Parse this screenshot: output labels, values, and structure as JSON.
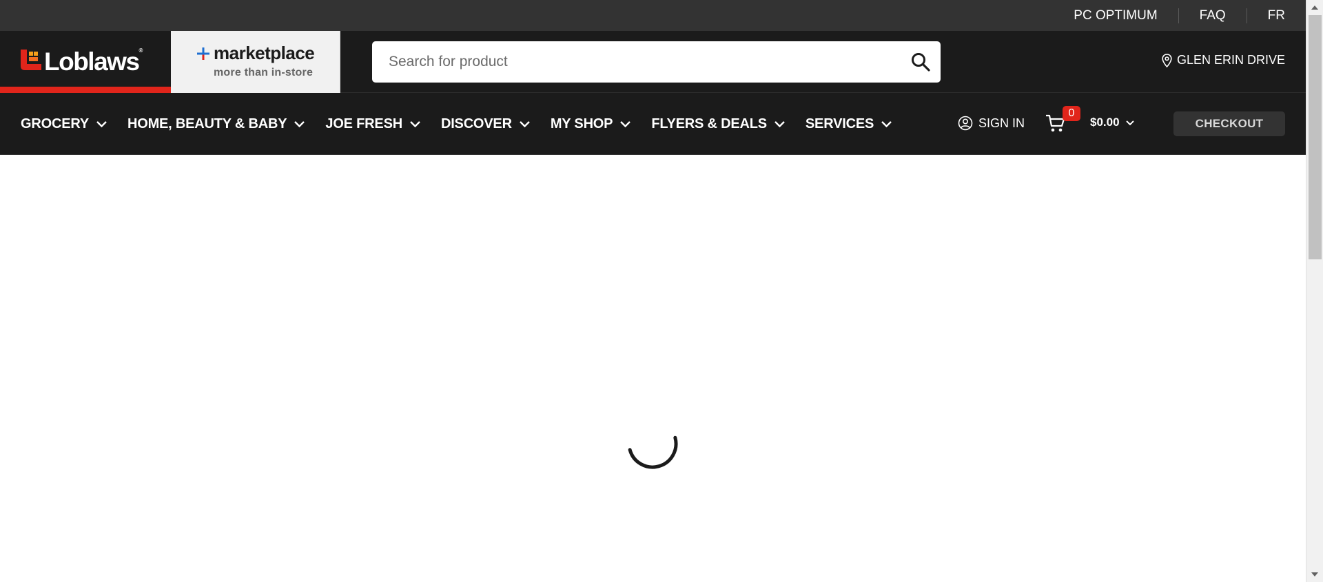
{
  "utility_bar": {
    "links": [
      "PC OPTIMUM",
      "FAQ",
      "FR"
    ]
  },
  "header": {
    "logo_text": "Loblaws",
    "logo_reg": "®",
    "marketplace_title": "marketplace",
    "marketplace_subtitle": "more than in-store",
    "search_placeholder": "Search for product",
    "store_name": "GLEN ERIN DRIVE"
  },
  "nav": {
    "items": [
      "GROCERY",
      "HOME, BEAUTY & BABY",
      "JOE FRESH",
      "DISCOVER",
      "MY SHOP",
      "FLYERS & DEALS",
      "SERVICES"
    ],
    "sign_in": "SIGN IN",
    "cart_count": "0",
    "cart_total": "$0.00",
    "checkout": "CHECKOUT"
  },
  "colors": {
    "brand_red": "#e1251b",
    "header_bg": "#1b1b1b",
    "utility_bg": "#333333"
  },
  "icons": [
    "loblaws-logo-icon",
    "marketplace-plus-icon",
    "search-icon",
    "location-pin-icon",
    "chevron-down-icon",
    "user-circle-icon",
    "cart-icon",
    "loading-spinner-icon"
  ]
}
